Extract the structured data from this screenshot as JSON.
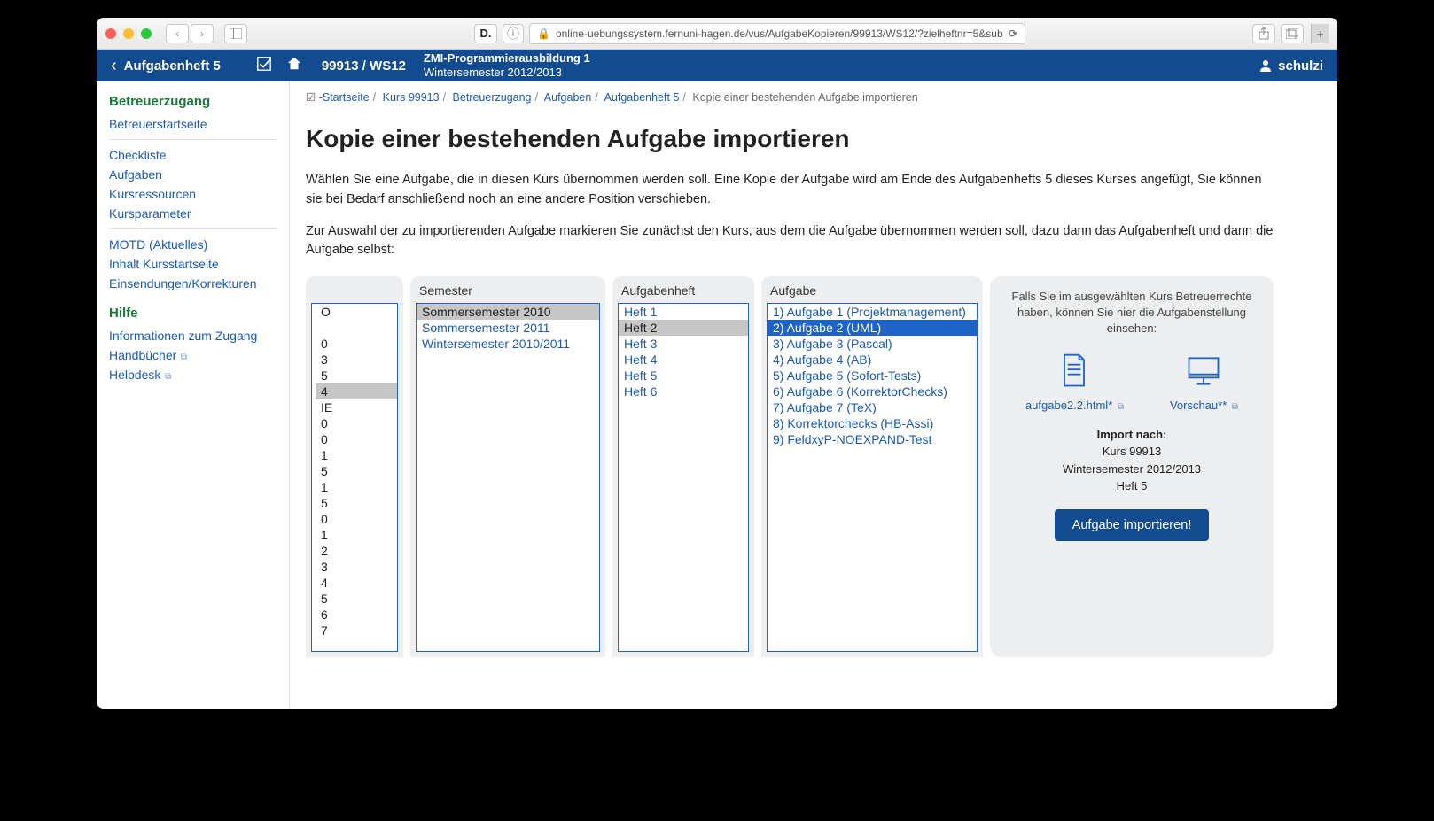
{
  "browser": {
    "url": "online-uebungssystem.fernuni-hagen.de/vus/AufgabeKopieren/99913/WS12/?zielheftnr=5&sub"
  },
  "header": {
    "back_label": "Aufgabenheft 5",
    "course_id": "99913 / WS12",
    "course_title": "ZMI-Programmierausbildung 1",
    "course_term": "Wintersemester 2012/2013",
    "user": "schulzi"
  },
  "sidebar": {
    "section1_title": "Betreuerzugang",
    "items1": [
      "Betreuerstartseite",
      "Checkliste",
      "Aufgaben",
      "Kursressourcen",
      "Kursparameter",
      "MOTD (Aktuelles)",
      "Inhalt Kursstartseite",
      "Einsendungen/Korrekturen"
    ],
    "section2_title": "Hilfe",
    "items2": [
      "Informationen zum Zugang",
      "Handbücher",
      "Helpdesk"
    ]
  },
  "breadcrumb": {
    "parts": [
      "-Startseite",
      "Kurs 99913",
      "Betreuerzugang",
      "Aufgaben",
      "Aufgabenheft 5"
    ],
    "current": "Kopie einer bestehenden Aufgabe importieren"
  },
  "main": {
    "h1": "Kopie einer bestehenden Aufgabe importieren",
    "p1": "Wählen Sie eine Aufgabe, die in diesen Kurs übernommen werden soll. Eine Kopie der Aufgabe wird am Ende des Aufgabenhefts 5 dieses Kurses angefügt, Sie können sie bei Bedarf anschließend noch an eine andere Position verschieben.",
    "p2": "Zur Auswahl der zu importierenden Aufgabe markieren Sie zunächst den Kurs, aus dem die Aufgabe übernommen werden soll, dazu dann das Aufgabenheft und dann die Aufgabe selbst:"
  },
  "columns": {
    "kurs_values": [
      "O",
      "",
      "0",
      "3",
      "5",
      "4",
      "IE",
      "0",
      "0",
      "1",
      "5",
      "1",
      "5",
      "0",
      "1",
      "2",
      "3",
      "4",
      "5",
      "6",
      "7"
    ],
    "kurs_selected_index": 5,
    "semester_head": "Semester",
    "semester_items": [
      "Sommersemester 2010",
      "Sommersemester 2011",
      "Wintersemester 2010/2011"
    ],
    "semester_selected_index": 0,
    "heft_head": "Aufgabenheft",
    "heft_items": [
      "Heft 1",
      "Heft 2",
      "Heft 3",
      "Heft 4",
      "Heft 5",
      "Heft 6"
    ],
    "heft_selected_index": 1,
    "aufgabe_head": "Aufgabe",
    "aufgabe_items": [
      "1) Aufgabe 1 (Projektmanagement)",
      "2) Aufgabe 2 (UML)",
      "3) Aufgabe 3 (Pascal)",
      "4) Aufgabe 4 (AB)",
      "5) Aufgabe 5 (Sofort-Tests)",
      "6) Aufgabe 6 (KorrektorChecks)",
      "7) Aufgabe 7 (TeX)",
      "8) Korrektorchecks (HB-Assi)",
      "9) FeldxyP-NOEXPAND-Test"
    ],
    "aufgabe_selected_index": 1
  },
  "preview": {
    "note": "Falls Sie im ausgewählten Kurs Betreuerrechte haben, können Sie hier die Aufgabenstellung einsehen:",
    "link1": "aufgabe2.2.html*",
    "link2": "Vorschau**",
    "target_label": "Import nach:",
    "target_kurs": "Kurs 99913",
    "target_term": "Wintersemester 2012/2013",
    "target_heft": "Heft 5",
    "button": "Aufgabe importieren!"
  }
}
